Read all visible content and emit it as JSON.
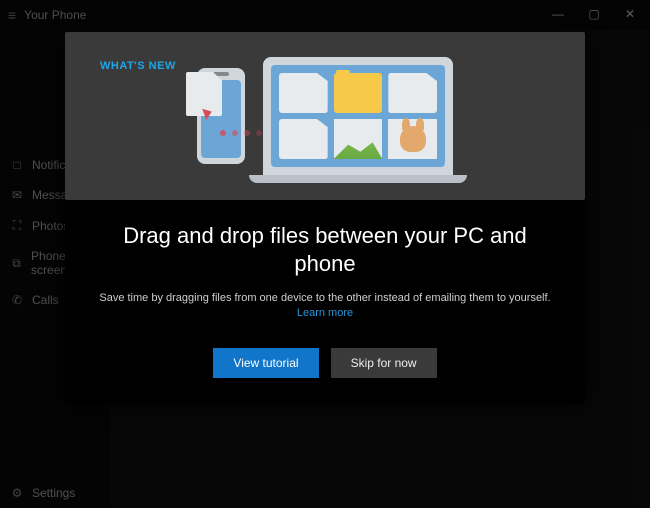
{
  "app": {
    "title": "Your Phone"
  },
  "window_controls": {
    "minimize": "—",
    "maximize": "▢",
    "close": "✕"
  },
  "sidebar": {
    "items": [
      {
        "icon": "bell-icon",
        "glyph": "□",
        "label": "Notifications"
      },
      {
        "icon": "messages-icon",
        "glyph": "✉",
        "label": "Messages"
      },
      {
        "icon": "photos-icon",
        "glyph": "⛶",
        "label": "Photos"
      },
      {
        "icon": "phonescreen-icon",
        "glyph": "⧉",
        "label": "Phone screen"
      },
      {
        "icon": "calls-icon",
        "glyph": "✆",
        "label": "Calls"
      }
    ],
    "settings": {
      "glyph": "⚙",
      "label": "Settings"
    }
  },
  "dialog": {
    "whats_new": "WHAT'S NEW",
    "title": "Drag and drop files between your PC and phone",
    "description": "Save time by dragging files from one device to the other instead of emailing them to yourself.",
    "learn_more": "Learn more",
    "primary_button": "View tutorial",
    "secondary_button": "Skip for now"
  }
}
